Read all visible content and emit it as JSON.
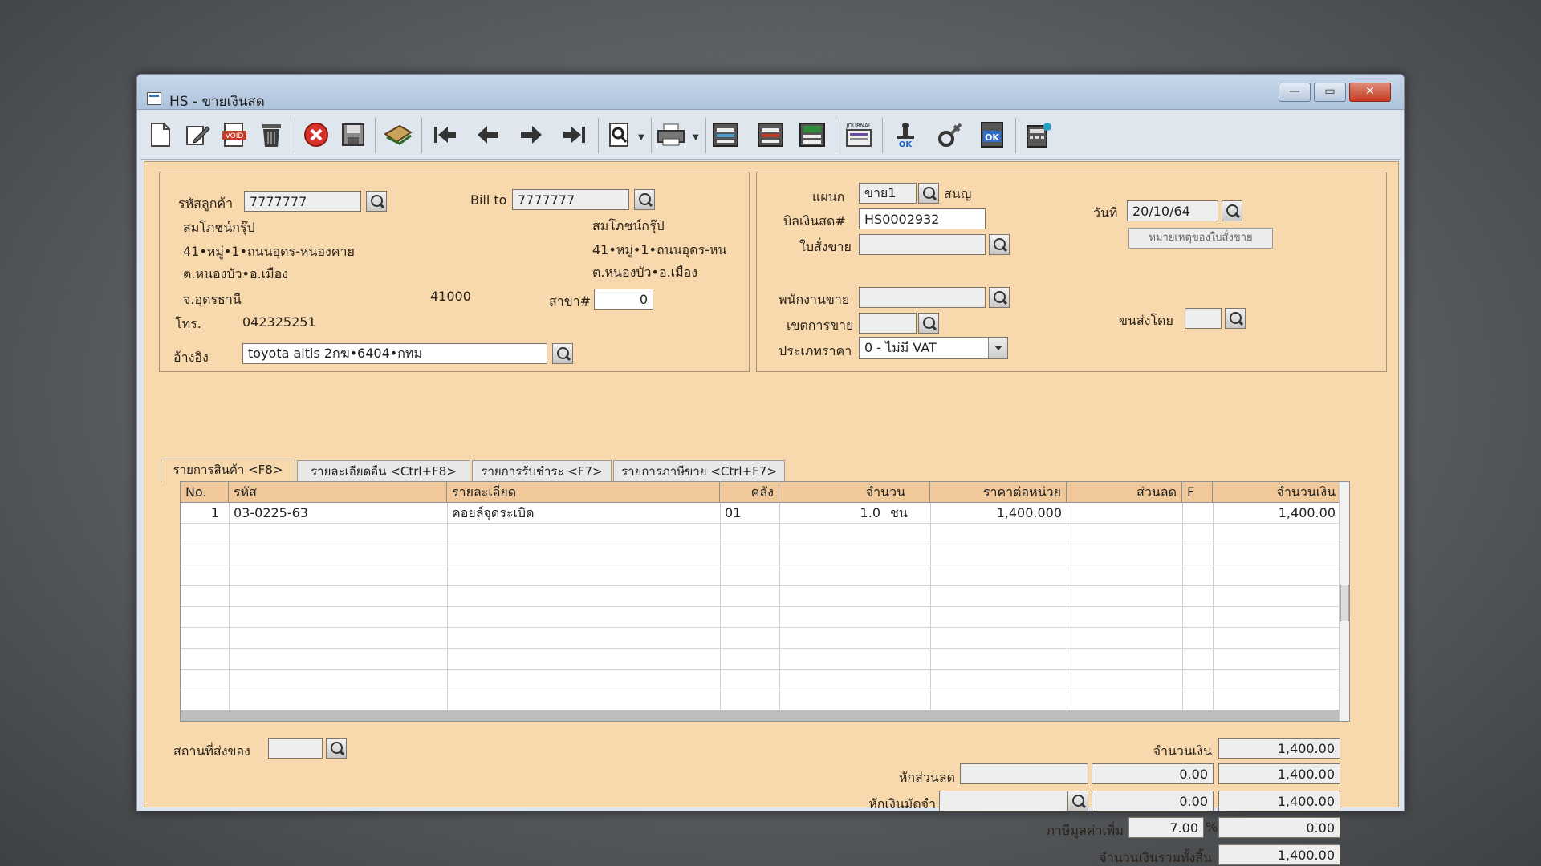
{
  "window": {
    "title": "HS - ขายเงินสด",
    "min": "—",
    "max": "▭",
    "close": "✕"
  },
  "toolbar": {
    "icons": [
      "new-icon",
      "edit-icon",
      "void-icon",
      "delete-icon",
      "cancel-icon",
      "save-icon",
      "notes-icon",
      "first-record-icon",
      "previous-record-icon",
      "next-record-icon",
      "last-record-icon",
      "find-icon",
      "print-icon",
      "document-icon",
      "form-icon",
      "document-stamp-icon",
      "journal-icon",
      "approve-icon",
      "tools-icon",
      "ok-icon",
      "calculator-icon"
    ],
    "labels": {
      "void": "VOID",
      "journal": "JOURNAL",
      "approve": "OK",
      "ok": "OK"
    }
  },
  "customer": {
    "code_label": "รหัสลูกค้า",
    "code": "7777777",
    "name": "สมโภชน์กรุ๊ป",
    "addr1": "41•หมู่•1•ถนนอุดร-หนองคาย",
    "addr2": "ต.หนองบัว•อ.เมือง",
    "addr3": "จ.อุดรธานี",
    "zip": "41000",
    "phone_label": "โทร.",
    "phone": "042325251",
    "ref_label": "อ้างอิง",
    "ref": "toyota altis 2กฆ•6404•กทม"
  },
  "billto": {
    "label": "Bill to",
    "code": "7777777",
    "name": "สมโภชน์กรุ๊ป",
    "addr1": "41•หมู่•1•ถนนอุดร-หน",
    "addr2": "ต.หนองบัว•อ.เมือง",
    "branch_label": "สาขา#",
    "branch": "0"
  },
  "doc": {
    "dept_label": "แผนก",
    "dept": "ขาย1",
    "dept_name": "สนญ",
    "bill_label": "บิลเงินสด#",
    "bill": "HS0002932",
    "so_label": "ใบสั่งขาย",
    "so": "",
    "date_label": "วันที่",
    "date": "20/10/64",
    "so_note_button": "หมายเหตุของใบสั่งขาย",
    "salesman_label": "พนักงานขาย",
    "salesman": "",
    "area_label": "เขตการขาย",
    "area": "",
    "shipby_label": "ขนส่งโดย",
    "shipby": "",
    "pricetype_label": "ประเภทราคา",
    "pricetype": "0 - ไม่มี VAT"
  },
  "tabs": [
    {
      "label": "รายการสินค้า <F8>"
    },
    {
      "label": "รายละเอียดอื่น <Ctrl+F8>"
    },
    {
      "label": "รายการรับชำระ <F7>"
    },
    {
      "label": "รายการภาษีขาย <Ctrl+F7>"
    }
  ],
  "table": {
    "headers": {
      "no": "No.",
      "code": "รหัส",
      "desc": "รายละเอียด",
      "wh": "คลัง",
      "qty": "จำนวน",
      "price": "ราคาต่อหน่วย",
      "disc": "ส่วนลด",
      "f": "F",
      "amount": "จำนวนเงิน"
    },
    "rows": [
      {
        "no": "1",
        "code": "03-0225-63",
        "desc": "คอยล์จุดระเบิด",
        "wh": "01",
        "qty": "1.0",
        "unit": "ชน",
        "price": "1,400.000",
        "disc": "",
        "f": "",
        "amount": "1,400.00"
      }
    ]
  },
  "footer": {
    "shipto_label": "สถานที่ส่งของ",
    "shipto": "",
    "amount_label": "จำนวนเงิน",
    "amount": "1,400.00",
    "discount_label": "หักส่วนลด",
    "discount_text": "",
    "discount_value": "0.00",
    "after_discount": "1,400.00",
    "deposit_label": "หักเงินมัดจำ",
    "deposit_text": "",
    "deposit_value": "0.00",
    "after_deposit": "1,400.00",
    "vat_label": "ภาษีมูลค่าเพิ่ม",
    "vat_rate": "7.00",
    "vat_pct": "%",
    "vat_amount": "0.00",
    "grand_label": "จำนวนเงินรวมทั้งสิ้น",
    "grand_total": "1,400.00"
  },
  "colors": {
    "form_bg": "#f7d9ad",
    "header_bg": "#f0c89a",
    "toolbar_bg": "#dfe6ee",
    "titlebar": "#b8cbe2"
  }
}
